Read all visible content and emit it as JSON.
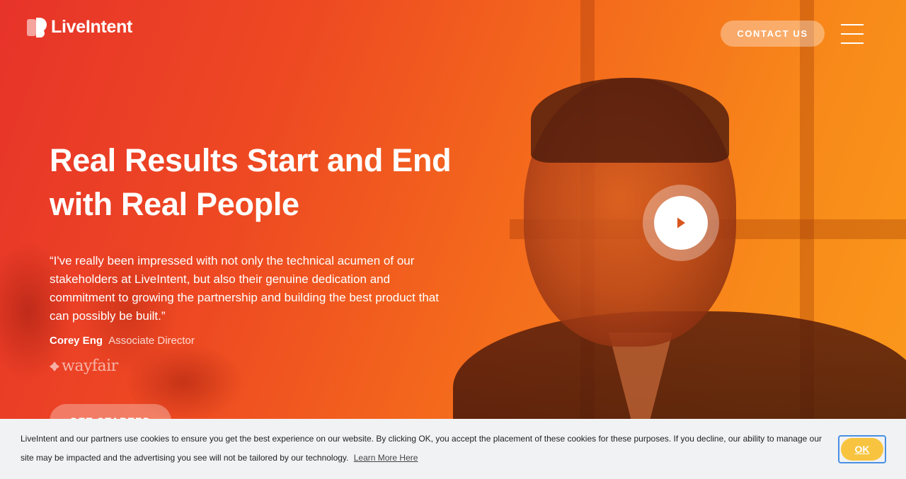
{
  "brand": {
    "name": "LiveIntent",
    "icon": "liveintent-logo-icon"
  },
  "nav": {
    "contact_label": "CONTACT US",
    "menu_icon": "hamburger-menu-icon"
  },
  "hero": {
    "headline_line1": "Real Results Start and End",
    "headline_line2": "with Real People",
    "quote": "“I've really been impressed with not only the technical acumen of our stakeholders at LiveIntent, but also their genuine dedication and commitment to growing the partnership and building the best product that can possibly be built.”",
    "person_name": "Corey Eng",
    "person_title": "Associate Director",
    "company_logo_text": "wayfair",
    "cta_label": "GET STARTED",
    "play_icon": "play-icon"
  },
  "cookie": {
    "message": "LiveIntent and our partners use cookies to ensure you get the best experience on our website. By clicking OK, you accept the placement of these cookies for these purposes. If you decline, our ability to manage our site may be impacted and the advertising you see will not be tailored by our technology.",
    "link_label": "Learn More Here",
    "ok_label": "OK"
  },
  "colors": {
    "gradient_start": "#e7332a",
    "gradient_end": "#fb9a1b",
    "ok_button": "#f8c43f",
    "focus_ring": "#4a90e2",
    "cookie_bg": "#f1f2f3"
  }
}
